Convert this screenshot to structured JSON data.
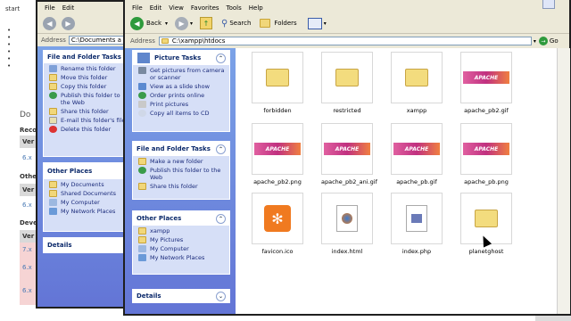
{
  "background_page": {
    "lines": [
      "start",
      "Do",
      "Reco",
      "Ver",
      "6.x",
      "Othe",
      "Ver",
      "6.x",
      "Deve",
      "Ver",
      "7.x",
      "6.x",
      "6.x"
    ]
  },
  "back_window": {
    "menu": [
      "File",
      "Edit",
      "View",
      "Favorites",
      "Tools",
      "Help"
    ],
    "address_label": "Address",
    "address_value": "C:\\Documents a",
    "tasks_title": "File and Folder Tasks",
    "tasks": [
      "Rename this folder",
      "Move this folder",
      "Copy this folder",
      "Publish this folder to the Web",
      "Share this folder",
      "E-mail this folder's files",
      "Delete this folder"
    ],
    "other_places_title": "Other Places",
    "other_places": [
      "My Documents",
      "Shared Documents",
      "My Computer",
      "My Network Places"
    ],
    "details_title": "Details"
  },
  "window": {
    "menu": [
      "File",
      "Edit",
      "View",
      "Favorites",
      "Tools",
      "Help"
    ],
    "back_label": "Back",
    "search_label": "Search",
    "folders_label": "Folders",
    "address_label": "Address",
    "address_value": "C:\\xampp\\htdocs",
    "go_label": "Go",
    "picture_tasks_title": "Picture Tasks",
    "picture_tasks": [
      "Get pictures from camera or scanner",
      "View as a slide show",
      "Order prints online",
      "Print pictures",
      "Copy all items to CD"
    ],
    "folder_tasks_title": "File and Folder Tasks",
    "folder_tasks": [
      "Make a new folder",
      "Publish this folder to the Web",
      "Share this folder"
    ],
    "other_places_title": "Other Places",
    "other_places": [
      "xampp",
      "My Pictures",
      "My Computer",
      "My Network Places"
    ],
    "details_title": "Details",
    "files": [
      {
        "name": "forbidden",
        "icon": "folder-icon"
      },
      {
        "name": "restricted",
        "icon": "folder-icon"
      },
      {
        "name": "xampp",
        "icon": "folder-icon"
      },
      {
        "name": "apache_pb2.gif",
        "icon": "apache-logo-thumbnail"
      },
      {
        "name": "apache_pb2.png",
        "icon": "apache-logo-thumbnail"
      },
      {
        "name": "apache_pb2_ani.gif",
        "icon": "apache-logo-thumbnail"
      },
      {
        "name": "apache_pb.gif",
        "icon": "apache-logo-thumbnail"
      },
      {
        "name": "apache_pb.png",
        "icon": "apache-logo-thumbnail"
      },
      {
        "name": "favicon.ico",
        "icon": "xampp-logo-icon"
      },
      {
        "name": "index.html",
        "icon": "firefox-document-icon"
      },
      {
        "name": "index.php",
        "icon": "php-document-icon"
      },
      {
        "name": "planetghost",
        "icon": "folder-icon"
      }
    ],
    "apache_logo_text": "APACHE"
  }
}
